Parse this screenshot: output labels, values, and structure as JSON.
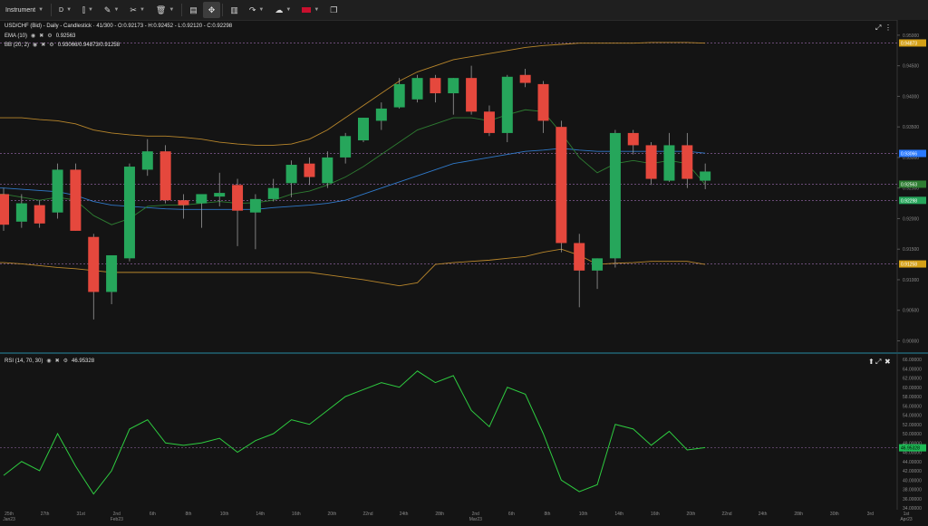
{
  "toolbar": {
    "instrument_label": "Instrument",
    "timeframe_label": "D",
    "icons": [
      "line-chart-icon",
      "pencil-icon",
      "scissors-icon",
      "trash-icon",
      "panel-icon",
      "expand-arrows-icon",
      "bar-chart-icon",
      "share-icon",
      "weather-icon",
      "uk-flag-icon",
      "window-icon"
    ]
  },
  "legend": {
    "symbol_line": "USD/CHF (Bid) - Daily - Candlestick · 41/300 - O:0.92173 - H:0.92452 - L:0.92120 - C:0.92298",
    "ema_label": "EMA (10)",
    "ema_value": "0.92563",
    "bb_label": "BB (20, 2)",
    "bb_value": "0.93066/0.94873/0.91258",
    "rsi_label": "RSI (14, 70, 30)",
    "rsi_value": "46.95328"
  },
  "price_axis": {
    "ticks": [
      "0.95000",
      "0.94500",
      "0.94000",
      "0.93500",
      "0.93000",
      "0.92500",
      "0.92000",
      "0.91500",
      "0.91000",
      "0.90500",
      "0.90000"
    ],
    "badges": [
      {
        "label": "0.94873",
        "color": "#d4a017"
      },
      {
        "label": "0.93066",
        "color": "#2979ff"
      },
      {
        "label": "0.92563",
        "color": "#2e7d32"
      },
      {
        "label": "0.92298",
        "color": "#26a65b"
      },
      {
        "label": "0.91258",
        "color": "#d4a017"
      }
    ]
  },
  "rsi_axis": {
    "ticks": [
      "66.00000",
      "64.00000",
      "62.00000",
      "60.00000",
      "58.00000",
      "56.00000",
      "54.00000",
      "52.00000",
      "50.00000",
      "48.00000",
      "46.00000",
      "44.00000",
      "42.00000",
      "40.00000",
      "38.00000",
      "36.00000",
      "34.00000"
    ],
    "badge": {
      "label": "46.95328",
      "color": "#1db954"
    }
  },
  "date_axis": {
    "labels": [
      "25th\nJan23",
      "27th",
      "31st",
      "2nd\nFeb23",
      "6th",
      "8th",
      "10th",
      "14th",
      "16th",
      "20th",
      "22nd",
      "24th",
      "28th",
      "2nd\nMar23",
      "6th",
      "8th",
      "10th",
      "14th",
      "16th",
      "20th",
      "22nd",
      "24th",
      "28th",
      "30th",
      "3rd",
      "1st\nApr23"
    ]
  },
  "chart_data": {
    "type": "candlestick",
    "title": "USD/CHF (Bid) - Daily - Candlestick",
    "ylim": [
      0.898,
      0.9525
    ],
    "candles": [
      {
        "o": 0.924,
        "h": 0.925,
        "l": 0.918,
        "c": 0.919
      },
      {
        "o": 0.9195,
        "h": 0.924,
        "l": 0.9185,
        "c": 0.9225
      },
      {
        "o": 0.9222,
        "h": 0.923,
        "l": 0.9185,
        "c": 0.9192
      },
      {
        "o": 0.921,
        "h": 0.929,
        "l": 0.92,
        "c": 0.928
      },
      {
        "o": 0.928,
        "h": 0.929,
        "l": 0.918,
        "c": 0.918
      },
      {
        "o": 0.917,
        "h": 0.9175,
        "l": 0.9035,
        "c": 0.908
      },
      {
        "o": 0.908,
        "h": 0.914,
        "l": 0.906,
        "c": 0.914
      },
      {
        "o": 0.9135,
        "h": 0.929,
        "l": 0.913,
        "c": 0.9285
      },
      {
        "o": 0.928,
        "h": 0.933,
        "l": 0.927,
        "c": 0.931
      },
      {
        "o": 0.931,
        "h": 0.932,
        "l": 0.9225,
        "c": 0.923
      },
      {
        "o": 0.923,
        "h": 0.924,
        "l": 0.92,
        "c": 0.9222
      },
      {
        "o": 0.9225,
        "h": 0.924,
        "l": 0.9185,
        "c": 0.924
      },
      {
        "o": 0.9236,
        "h": 0.9275,
        "l": 0.922,
        "c": 0.9242
      },
      {
        "o": 0.9255,
        "h": 0.9265,
        "l": 0.9155,
        "c": 0.9213
      },
      {
        "o": 0.921,
        "h": 0.924,
        "l": 0.915,
        "c": 0.9232
      },
      {
        "o": 0.9232,
        "h": 0.9265,
        "l": 0.9228,
        "c": 0.925
      },
      {
        "o": 0.9258,
        "h": 0.9295,
        "l": 0.9235,
        "c": 0.9288
      },
      {
        "o": 0.929,
        "h": 0.93,
        "l": 0.9255,
        "c": 0.9268
      },
      {
        "o": 0.9258,
        "h": 0.931,
        "l": 0.925,
        "c": 0.93
      },
      {
        "o": 0.93,
        "h": 0.934,
        "l": 0.929,
        "c": 0.9335
      },
      {
        "o": 0.9328,
        "h": 0.9365,
        "l": 0.9325,
        "c": 0.9365
      },
      {
        "o": 0.936,
        "h": 0.939,
        "l": 0.9345,
        "c": 0.938
      },
      {
        "o": 0.9382,
        "h": 0.943,
        "l": 0.938,
        "c": 0.942
      },
      {
        "o": 0.9395,
        "h": 0.9435,
        "l": 0.939,
        "c": 0.943
      },
      {
        "o": 0.943,
        "h": 0.9435,
        "l": 0.939,
        "c": 0.9405
      },
      {
        "o": 0.9405,
        "h": 0.943,
        "l": 0.937,
        "c": 0.943
      },
      {
        "o": 0.943,
        "h": 0.945,
        "l": 0.937,
        "c": 0.9375
      },
      {
        "o": 0.9375,
        "h": 0.9385,
        "l": 0.9335,
        "c": 0.934
      },
      {
        "o": 0.934,
        "h": 0.9435,
        "l": 0.9325,
        "c": 0.9432
      },
      {
        "o": 0.9435,
        "h": 0.9445,
        "l": 0.9415,
        "c": 0.9422
      },
      {
        "o": 0.942,
        "h": 0.9425,
        "l": 0.934,
        "c": 0.936
      },
      {
        "o": 0.935,
        "h": 0.936,
        "l": 0.9145,
        "c": 0.916
      },
      {
        "o": 0.916,
        "h": 0.9175,
        "l": 0.9055,
        "c": 0.9115
      },
      {
        "o": 0.9115,
        "h": 0.9135,
        "l": 0.9085,
        "c": 0.9135
      },
      {
        "o": 0.9135,
        "h": 0.9345,
        "l": 0.912,
        "c": 0.934
      },
      {
        "o": 0.934,
        "h": 0.9345,
        "l": 0.9305,
        "c": 0.932
      },
      {
        "o": 0.932,
        "h": 0.9325,
        "l": 0.9255,
        "c": 0.9265
      },
      {
        "o": 0.9262,
        "h": 0.934,
        "l": 0.926,
        "c": 0.932
      },
      {
        "o": 0.932,
        "h": 0.934,
        "l": 0.925,
        "c": 0.9265
      },
      {
        "o": 0.9262,
        "h": 0.929,
        "l": 0.9248,
        "c": 0.9277
      }
    ],
    "series": [
      {
        "name": "BB upper",
        "values": [
          0.9365,
          0.9365,
          0.9362,
          0.936,
          0.9355,
          0.9345,
          0.934,
          0.9337,
          0.9335,
          0.9335,
          0.9333,
          0.933,
          0.9325,
          0.9322,
          0.932,
          0.932,
          0.9322,
          0.933,
          0.9345,
          0.9365,
          0.9385,
          0.9405,
          0.9425,
          0.944,
          0.945,
          0.946,
          0.9465,
          0.947,
          0.9475,
          0.948,
          0.9483,
          0.9485,
          0.9487,
          0.9487,
          0.9487,
          0.9487,
          0.9488,
          0.9488,
          0.9488,
          0.9487
        ]
      },
      {
        "name": "BB middle",
        "values": [
          0.925,
          0.9248,
          0.9246,
          0.9244,
          0.9238,
          0.9228,
          0.9222,
          0.922,
          0.9218,
          0.9216,
          0.9215,
          0.9215,
          0.9215,
          0.9215,
          0.9215,
          0.9218,
          0.922,
          0.9222,
          0.9225,
          0.923,
          0.924,
          0.925,
          0.926,
          0.927,
          0.928,
          0.929,
          0.9295,
          0.93,
          0.9305,
          0.931,
          0.9312,
          0.9315,
          0.9312,
          0.931,
          0.931,
          0.931,
          0.931,
          0.931,
          0.931,
          0.9307
        ]
      },
      {
        "name": "EMA",
        "values": [
          0.924,
          0.9235,
          0.923,
          0.9235,
          0.923,
          0.9205,
          0.919,
          0.92,
          0.922,
          0.9222,
          0.9222,
          0.9225,
          0.9228,
          0.9225,
          0.9226,
          0.923,
          0.924,
          0.9245,
          0.9255,
          0.9268,
          0.9285,
          0.9305,
          0.9325,
          0.9345,
          0.9355,
          0.9365,
          0.9365,
          0.936,
          0.937,
          0.9378,
          0.9375,
          0.934,
          0.93,
          0.9275,
          0.929,
          0.9295,
          0.929,
          0.9295,
          0.929,
          0.9256
        ]
      },
      {
        "name": "BB lower",
        "values": [
          0.9128,
          0.9126,
          0.9123,
          0.912,
          0.9118,
          0.9115,
          0.9112,
          0.9112,
          0.9112,
          0.9112,
          0.9112,
          0.9112,
          0.9112,
          0.9112,
          0.9112,
          0.9112,
          0.9112,
          0.9112,
          0.9108,
          0.9104,
          0.91,
          0.9095,
          0.909,
          0.9095,
          0.9125,
          0.9128,
          0.913,
          0.9132,
          0.9135,
          0.9138,
          0.9145,
          0.915,
          0.914,
          0.9125,
          0.9127,
          0.9128,
          0.913,
          0.913,
          0.913,
          0.9125
        ]
      }
    ],
    "rsi": [
      41,
      44,
      42,
      50,
      43,
      37,
      42,
      51,
      53,
      48,
      47.5,
      48,
      49,
      46,
      48.5,
      50,
      53,
      52,
      55,
      58,
      59.5,
      61,
      60,
      63.5,
      61,
      62.5,
      55,
      51.5,
      60,
      58.5,
      50,
      40,
      37.5,
      39,
      52,
      51,
      47.5,
      50.5,
      46.5,
      47
    ]
  }
}
